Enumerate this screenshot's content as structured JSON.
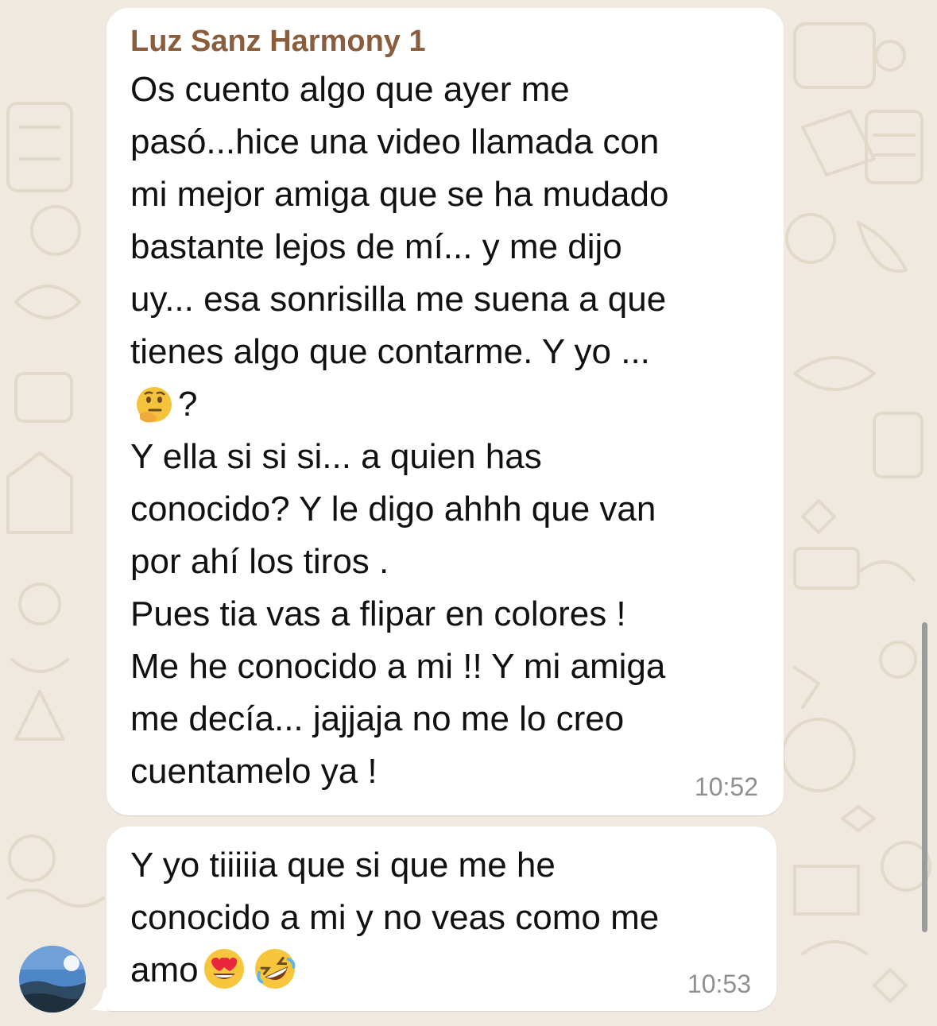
{
  "chat": {
    "messages": [
      {
        "sender": "Luz Sanz Harmony 1",
        "text_before_emoji": "Os cuento algo que ayer me\npasó...hice una video llamada con\nmi mejor amiga que se ha mudado\nbastante lejos de mí... y me dijo\nuy... esa sonrisilla me suena a que\ntienes algo que contarme. Y yo ...\n",
        "emoji_1": "thinking-face-icon",
        "text_after_emoji": "?\nY ella si si si... a quien has\nconocido? Y le digo ahhh que van\npor ahí los tiros .\nPues tia vas a flipar en colores !\nMe he conocido a mi !! Y mi amiga\nme decía... jajjaja no me lo creo\ncuentamelo ya !",
        "time": "10:52"
      },
      {
        "text": "Y yo tiiiiia que si que me he\nconocido a mi y no veas como me\namo",
        "emoji_1": "heart-eyes-face-icon",
        "emoji_2": "rolling-laughing-face-icon",
        "time": "10:53"
      }
    ]
  },
  "colors": {
    "background": "#efe9df",
    "bubble": "#ffffff",
    "sender_name": "#8a5d3c",
    "timestamp": "#8f8f8f",
    "text": "#111111"
  }
}
